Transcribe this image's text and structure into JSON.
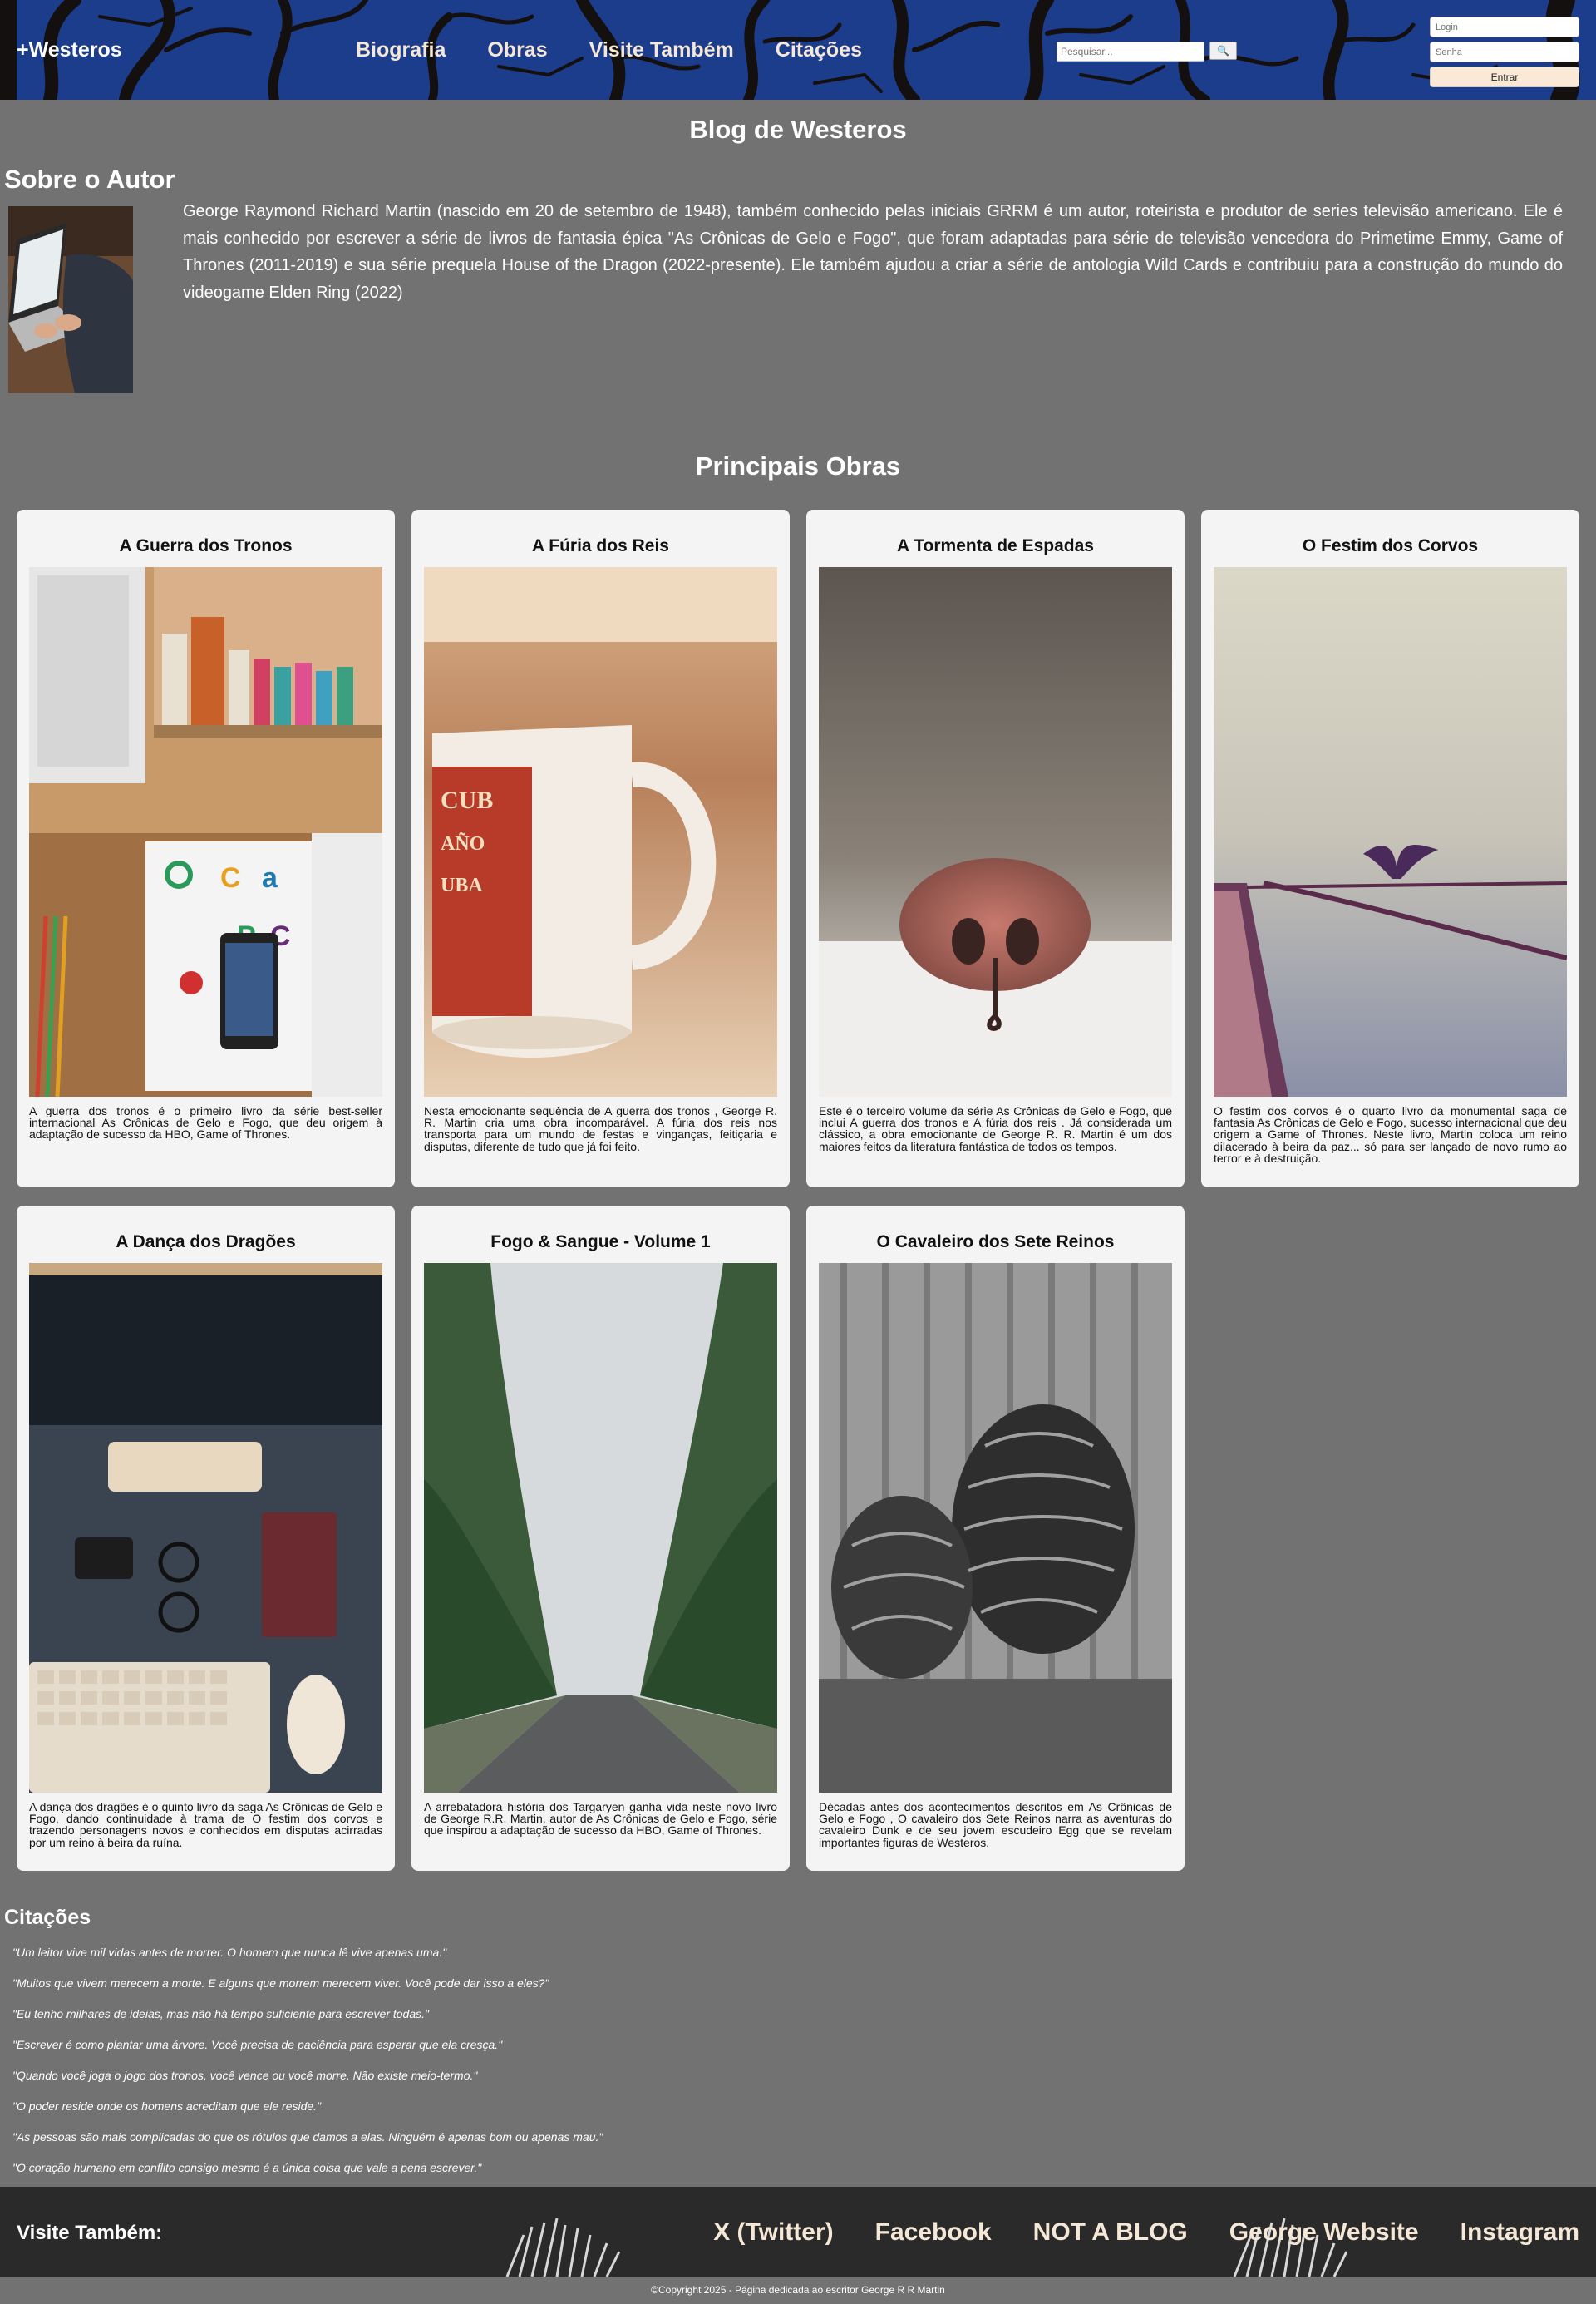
{
  "header": {
    "brand": "+Westeros",
    "nav": [
      "Biografia",
      "Obras",
      "Visite Também",
      "Citações"
    ],
    "search_placeholder": "Pesquisar...",
    "search_button": "🔍",
    "login_placeholder": "Login",
    "password_placeholder": "Senha",
    "login_button": "Entrar"
  },
  "blog_title": "Blog de Westeros",
  "about": {
    "title": "Sobre o Autor",
    "text": "George Raymond Richard Martin (nascido em 20 de setembro de 1948), também conhecido pelas iniciais GRRM é um autor, roteirista e produtor de series televisão americano. Ele é mais conhecido por escrever a série de livros de fantasia épica \"As Crônicas de Gelo e Fogo\", que foram adaptadas para série de televisão vencedora do Primetime Emmy, Game of Thrones (2011-2019) e sua série prequela House of the Dragon (2022-presente). Ele também ajudou a criar a série de antologia Wild Cards e contribuiu para a construção do mundo do videogame Elden Ring (2022)"
  },
  "works": {
    "title": "Principais Obras",
    "items": [
      {
        "title": "A Guerra dos Tronos",
        "text": "A guerra dos tronos é o primeiro livro da série best-seller internacional As Crônicas de Gelo e Fogo, que deu origem à adaptação de sucesso da HBO, Game of Thrones."
      },
      {
        "title": "A Fúria dos Reis",
        "text": "Nesta emocionante sequência de A guerra dos tronos , George R. R. Martin cria uma obra incomparável. A fúria dos reis nos transporta para um mundo de festas e vinganças, feitiçaria e disputas, diferente de tudo que já foi feito."
      },
      {
        "title": "A Tormenta de Espadas",
        "text": "Este é o terceiro volume da série As Crônicas de Gelo e Fogo, que inclui A guerra dos tronos e A fúria dos reis . Já considerada um clássico, a obra emocionante de George R. R. Martin é um dos maiores feitos da literatura fantástica de todos os tempos."
      },
      {
        "title": "O Festim dos Corvos",
        "text": "O festim dos corvos é o quarto livro da monumental saga de fantasia As Crônicas de Gelo e Fogo, sucesso internacional que deu origem a Game of Thrones. Neste livro, Martin coloca um reino dilacerado à beira da paz... só para ser lançado de novo rumo ao terror e à destruição."
      },
      {
        "title": "A Dança dos Dragões",
        "text": "A dança dos dragões é o quinto livro da saga As Crônicas de Gelo e Fogo, dando continuidade à trama de O festim dos corvos e trazendo personagens novos e conhecidos em disputas acirradas por um reino à beira da ruína."
      },
      {
        "title": "Fogo & Sangue - Volume 1",
        "text": "A arrebatadora história dos Targaryen ganha vida neste novo livro de George R.R. Martin, autor de As Crônicas de Gelo e Fogo, série que inspirou a adaptação de sucesso da HBO, Game of Thrones."
      },
      {
        "title": "O Cavaleiro dos Sete Reinos",
        "text": "Décadas antes dos acontecimentos descritos em As Crônicas de Gelo e Fogo , O cavaleiro dos Sete Reinos narra as aventuras do cavaleiro Dunk e de seu jovem escudeiro Egg que se revelam importantes figuras de Westeros."
      }
    ]
  },
  "quotes": {
    "title": "Citações",
    "items": [
      "\"Um leitor vive mil vidas antes de morrer. O homem que nunca lê vive apenas uma.\"",
      "\"Muitos que vivem merecem a morte. E alguns que morrem merecem viver. Você pode dar isso a eles?\"",
      "\"Eu tenho milhares de ideias, mas não há tempo suficiente para escrever todas.\"",
      "\"Escrever é como plantar uma árvore. Você precisa de paciência para esperar que ela cresça.\"",
      "\"Quando você joga o jogo dos tronos, você vence ou você morre. Não existe meio-termo.\"",
      "\"O poder reside onde os homens acreditam que ele reside.\"",
      "\"As pessoas são mais complicadas do que os rótulos que damos a elas. Ninguém é apenas bom ou apenas mau.\"",
      "\"O coração humano em conflito consigo mesmo é a única coisa que vale a pena escrever.\""
    ]
  },
  "footer": {
    "label": "Visite Também:",
    "links": [
      "X (Twitter)",
      "Facebook",
      "NOT A BLOG",
      "George Website",
      "Instagram"
    ],
    "copyright": "©Copyright 2025 - Página dedicada ao escritor George R R Martin"
  },
  "colors": {
    "background": "#727272",
    "header": "#1c3c8c",
    "card": "#f4f4f4",
    "nav_text": "#f6e8d6",
    "footer": "#2a2a2a"
  }
}
